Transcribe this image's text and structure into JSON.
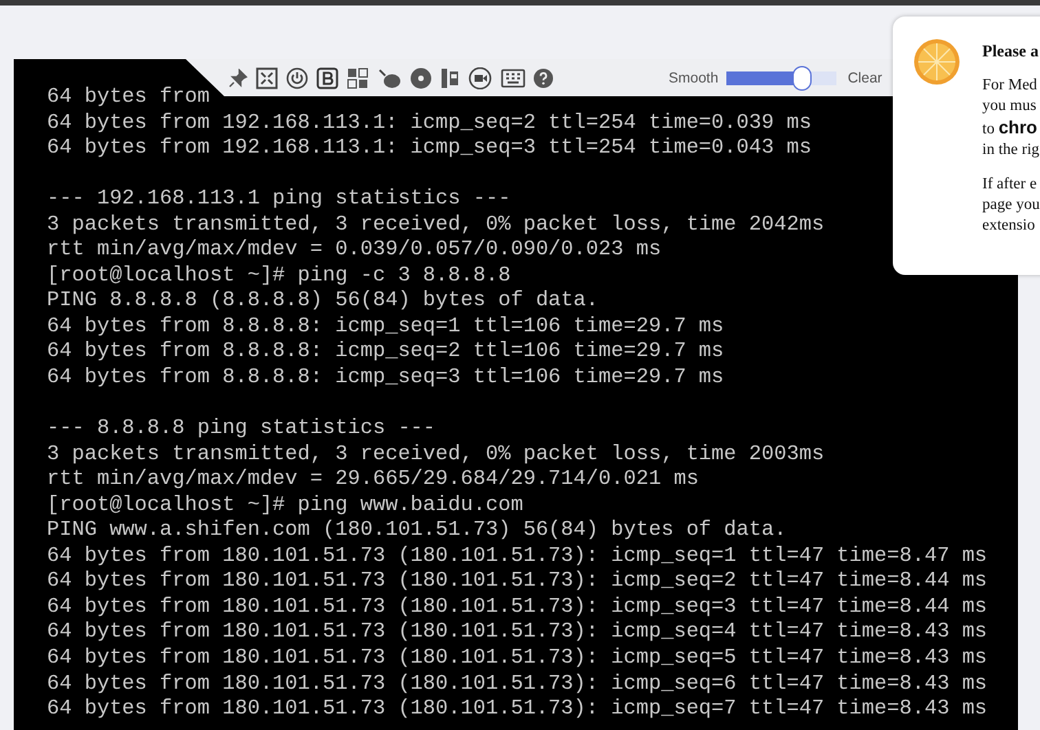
{
  "toolbar": {
    "slider": {
      "left_label": "Smooth",
      "right_label": "Clear",
      "level": 0.68
    }
  },
  "terminal": {
    "blocks": [
      [
        "64 bytes from",
        "64 bytes from 192.168.113.1: icmp_seq=2 ttl=254 time=0.039 ms",
        "64 bytes from 192.168.113.1: icmp_seq=3 ttl=254 time=0.043 ms"
      ],
      [
        "--- 192.168.113.1 ping statistics ---",
        "3 packets transmitted, 3 received, 0% packet loss, time 2042ms",
        "rtt min/avg/max/mdev = 0.039/0.057/0.090/0.023 ms",
        "[root@localhost ~]# ping -c 3 8.8.8.8",
        "PING 8.8.8.8 (8.8.8.8) 56(84) bytes of data.",
        "64 bytes from 8.8.8.8: icmp_seq=1 ttl=106 time=29.7 ms",
        "64 bytes from 8.8.8.8: icmp_seq=2 ttl=106 time=29.7 ms",
        "64 bytes from 8.8.8.8: icmp_seq=3 ttl=106 time=29.7 ms"
      ],
      [
        "--- 8.8.8.8 ping statistics ---",
        "3 packets transmitted, 3 received, 0% packet loss, time 2003ms",
        "rtt min/avg/max/mdev = 29.665/29.684/29.714/0.021 ms",
        "[root@localhost ~]# ping www.baidu.com",
        "PING www.a.shifen.com (180.101.51.73) 56(84) bytes of data.",
        "64 bytes from 180.101.51.73 (180.101.51.73): icmp_seq=1 ttl=47 time=8.47 ms",
        "64 bytes from 180.101.51.73 (180.101.51.73): icmp_seq=2 ttl=47 time=8.44 ms",
        "64 bytes from 180.101.51.73 (180.101.51.73): icmp_seq=3 ttl=47 time=8.44 ms",
        "64 bytes from 180.101.51.73 (180.101.51.73): icmp_seq=4 ttl=47 time=8.43 ms",
        "64 bytes from 180.101.51.73 (180.101.51.73): icmp_seq=5 ttl=47 time=8.43 ms",
        "64 bytes from 180.101.51.73 (180.101.51.73): icmp_seq=6 ttl=47 time=8.43 ms",
        "64 bytes from 180.101.51.73 (180.101.51.73): icmp_seq=7 ttl=47 time=8.43 ms"
      ]
    ]
  },
  "popup": {
    "title": "Please a",
    "paragraphs": [
      [
        "For Med",
        "you mus",
        "to **chro**",
        "in the rig"
      ],
      [
        "If after e",
        "page you",
        "extensio"
      ]
    ]
  }
}
